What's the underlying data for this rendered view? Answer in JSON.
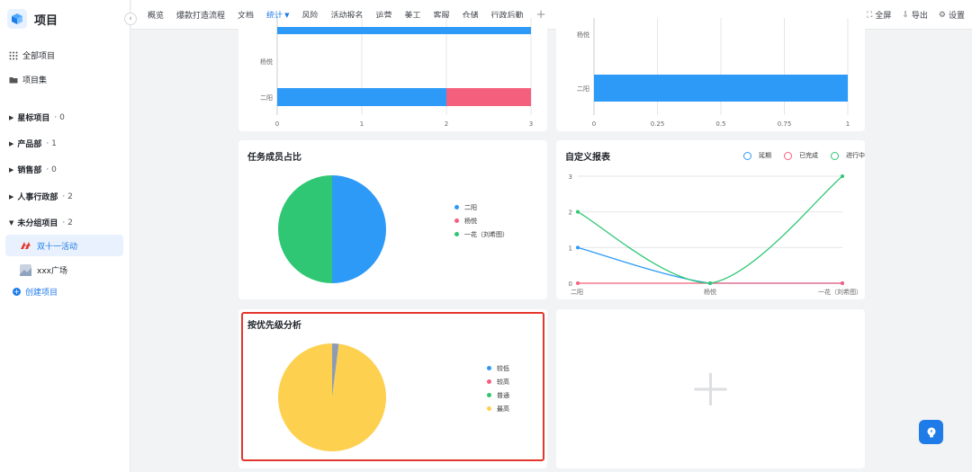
{
  "sidebar": {
    "brand_title": "项目",
    "all_projects": "全部项目",
    "project_sets": "项目集",
    "groups": [
      {
        "label": "星标项目",
        "count": "0"
      },
      {
        "label": "产品部",
        "count": "1"
      },
      {
        "label": "销售部",
        "count": "0"
      },
      {
        "label": "人事行政部",
        "count": "2"
      },
      {
        "label": "未分组项目",
        "count": "2"
      }
    ],
    "projects": [
      {
        "label": "双十一活动",
        "active": true
      },
      {
        "label": "xxx广场",
        "active": false
      }
    ],
    "create_label": "创建项目"
  },
  "topbar": {
    "tabs": [
      {
        "label": "概览"
      },
      {
        "label": "爆款打造流程"
      },
      {
        "label": "文档"
      },
      {
        "label": "统计",
        "active": true
      },
      {
        "label": "风险"
      },
      {
        "label": "活动报名"
      },
      {
        "label": "运营"
      },
      {
        "label": "美工"
      },
      {
        "label": "客服"
      },
      {
        "label": "仓储"
      },
      {
        "label": "行政后勤"
      }
    ],
    "actions": {
      "fullscreen": "全屏",
      "export": "导出",
      "settings": "设置"
    }
  },
  "colors": {
    "blue": "#2d9af7",
    "pink": "#f55f7e",
    "green": "#2fc774",
    "yellow": "#fdd04f",
    "gray": "#8f9bb3",
    "accent": "#1f7be8"
  },
  "cards": {
    "member_share": {
      "title": "任务成员占比",
      "legend": [
        "二阳",
        "杨悦",
        "一花（刘希图）"
      ]
    },
    "custom_report": {
      "title": "自定义报表",
      "legend": [
        "延期",
        "已完成",
        "进行中"
      ]
    },
    "priority": {
      "title": "按优先级分析",
      "legend": [
        "较低",
        "较高",
        "普通",
        "最高"
      ]
    }
  },
  "chart_data": [
    {
      "type": "bar",
      "orientation": "horizontal",
      "stacked": true,
      "categories": [
        "杨悦",
        "二阳"
      ],
      "xticks": [
        "0",
        "1",
        "2",
        "3"
      ],
      "xlim": [
        0,
        3
      ],
      "series": [
        {
          "values": [
            3,
            2
          ],
          "color": "#2d9af7"
        },
        {
          "values": [
            0,
            1
          ],
          "color": "#f55f7e"
        }
      ],
      "note_partial": "top category cropped at top of view"
    },
    {
      "type": "bar",
      "orientation": "horizontal",
      "categories": [
        "杨悦",
        "二阳"
      ],
      "xticks": [
        "0",
        "0.25",
        "0.5",
        "0.75",
        "1"
      ],
      "xlim": [
        0,
        1
      ],
      "series": [
        {
          "values": [
            0,
            1
          ],
          "color": "#2d9af7"
        }
      ]
    },
    {
      "type": "pie",
      "title": "任务成员占比",
      "labels": [
        "二阳",
        "杨悦",
        "一花（刘希图）"
      ],
      "values": [
        50,
        0,
        50
      ],
      "colors": [
        "#2d9af7",
        "#f55f7e",
        "#2fc774"
      ]
    },
    {
      "type": "line",
      "title": "自定义报表",
      "categories": [
        "二阳",
        "杨悦",
        "一花（刘希图）"
      ],
      "ylim": [
        0,
        3
      ],
      "yticks": [
        "0",
        "1",
        "2",
        "3"
      ],
      "series": [
        {
          "name": "延期",
          "values": [
            1,
            0,
            0
          ],
          "color": "#2d9af7"
        },
        {
          "name": "已完成",
          "values": [
            0,
            0,
            0
          ],
          "color": "#f55f7e"
        },
        {
          "name": "进行中",
          "values": [
            2,
            0,
            3
          ],
          "color": "#2fc774"
        }
      ],
      "legend": "top-right",
      "grid": true
    },
    {
      "type": "pie",
      "title": "按优先级分析",
      "labels": [
        "较低",
        "较高",
        "普通",
        "最高"
      ],
      "values": [
        2,
        0,
        0,
        98
      ],
      "colors": [
        "#8f9bb3",
        "#f55f7e",
        "#2fc774",
        "#fdd04f"
      ]
    }
  ]
}
